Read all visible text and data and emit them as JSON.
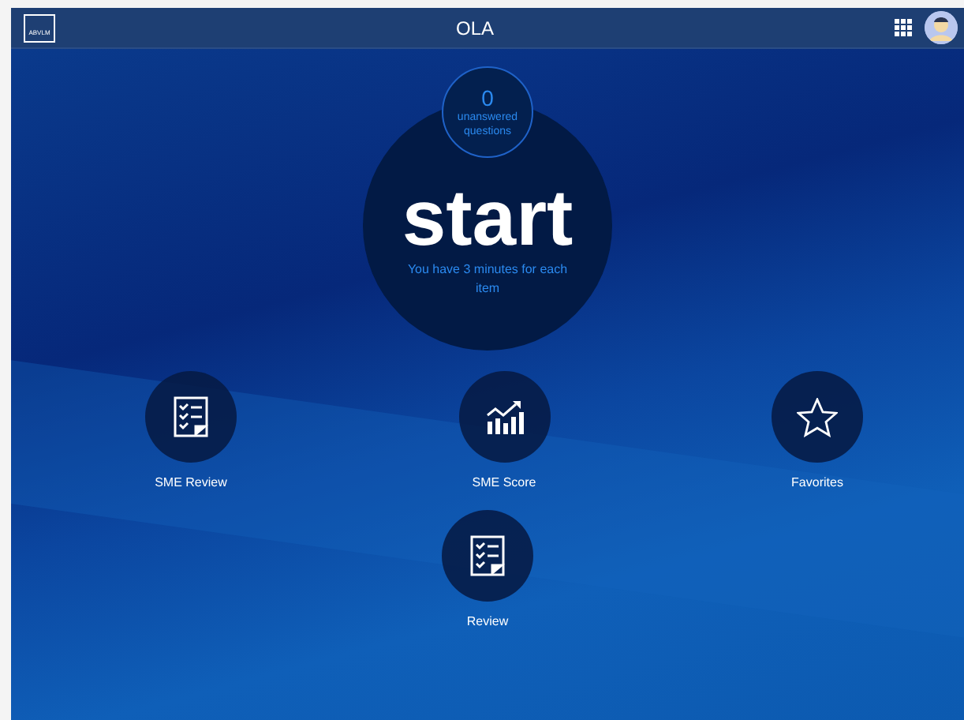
{
  "header": {
    "logo_text": "ABVLM",
    "title": "OLA"
  },
  "start": {
    "count": "0",
    "count_label": "unanswered questions",
    "button": "start",
    "hint": "You have 3 minutes for each item"
  },
  "menu": [
    {
      "label": "SME Review",
      "kind": "checklist"
    },
    {
      "label": "SME Score",
      "kind": "chart"
    },
    {
      "label": "Favorites",
      "kind": "star"
    },
    {
      "label": "Review",
      "kind": "checklist"
    }
  ]
}
